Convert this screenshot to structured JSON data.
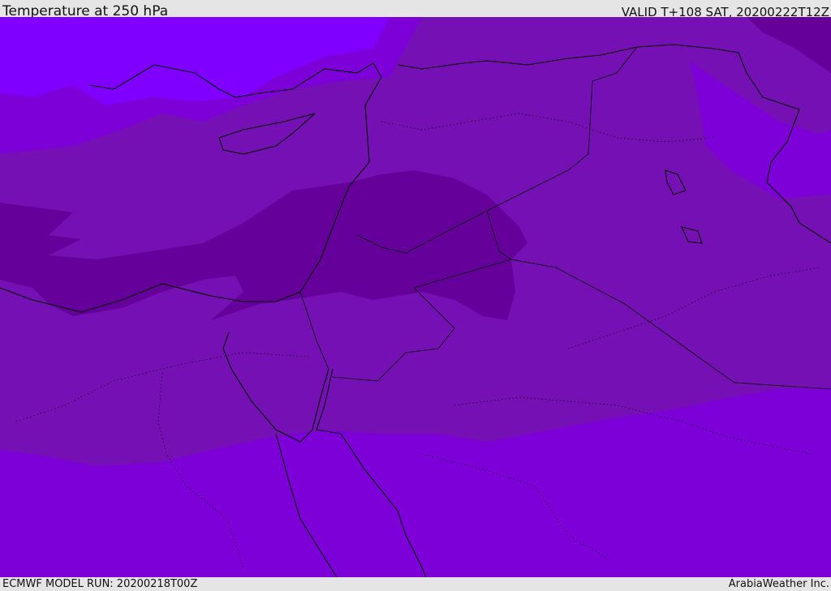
{
  "header": {
    "title": "Temperature at 250 hPa",
    "valid": "VALID T+108 SAT, 20200222T12Z"
  },
  "footer": {
    "model_run": "ECMWF MODEL RUN: 20200218T00Z",
    "credit": "ArabiaWeather Inc."
  },
  "colors": {
    "coldest": "#7f00ff",
    "cold": "#7e00d9",
    "mid": "#7510b4",
    "warm": "#66009a",
    "coast": "#000000"
  }
}
